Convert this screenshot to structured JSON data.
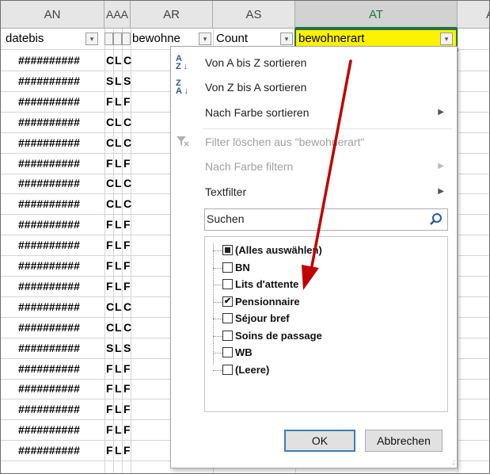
{
  "columns": [
    {
      "label": "AN"
    },
    {
      "label": "AAA"
    },
    {
      "label": "AR"
    },
    {
      "label": "AS"
    },
    {
      "label": "AT"
    },
    {
      "label": "A"
    }
  ],
  "header_row": {
    "col_an": "datebis",
    "col_aaa": "",
    "col_ar": "bewohne",
    "col_as": "Count",
    "col_at": "bewohnerart",
    "filter_glyph": "▾"
  },
  "rows": [
    {
      "an": "##########",
      "a1": "C",
      "a2": "L",
      "a3": "C"
    },
    {
      "an": "##########",
      "a1": "S",
      "a2": "L",
      "a3": "S"
    },
    {
      "an": "##########",
      "a1": "F",
      "a2": "L",
      "a3": "F"
    },
    {
      "an": "##########",
      "a1": "C",
      "a2": "L",
      "a3": "C"
    },
    {
      "an": "##########",
      "a1": "C",
      "a2": "L",
      "a3": "C"
    },
    {
      "an": "##########",
      "a1": "F",
      "a2": "L",
      "a3": "F"
    },
    {
      "an": "##########",
      "a1": "C",
      "a2": "L",
      "a3": "C"
    },
    {
      "an": "##########",
      "a1": "C",
      "a2": "L",
      "a3": "C"
    },
    {
      "an": "##########",
      "a1": "F",
      "a2": "L",
      "a3": "F"
    },
    {
      "an": "##########",
      "a1": "F",
      "a2": "L",
      "a3": "F"
    },
    {
      "an": "##########",
      "a1": "F",
      "a2": "L",
      "a3": "F"
    },
    {
      "an": "##########",
      "a1": "F",
      "a2": "L",
      "a3": "F"
    },
    {
      "an": "##########",
      "a1": "C",
      "a2": "L",
      "a3": "C"
    },
    {
      "an": "##########",
      "a1": "C",
      "a2": "L",
      "a3": "C"
    },
    {
      "an": "##########",
      "a1": "S",
      "a2": "L",
      "a3": "S"
    },
    {
      "an": "##########",
      "a1": "F",
      "a2": "L",
      "a3": "F"
    },
    {
      "an": "##########",
      "a1": "F",
      "a2": "L",
      "a3": "F"
    },
    {
      "an": "##########",
      "a1": "F",
      "a2": "L",
      "a3": "F"
    },
    {
      "an": "##########",
      "a1": "F",
      "a2": "L",
      "a3": "F"
    },
    {
      "an": "##########",
      "a1": "F",
      "a2": "L",
      "a3": "F"
    }
  ],
  "menu": {
    "sort_az": "Von A bis Z sortieren",
    "sort_za": "Von Z bis A sortieren",
    "sort_color": "Nach Farbe sortieren",
    "clear_filter": "Filter löschen aus \"bewohnerart\"",
    "filter_color": "Nach Farbe filtern",
    "text_filter": "Textfilter",
    "submenu_glyph": "▶",
    "sort_az_icon_top": "A",
    "sort_az_icon_bottom": "Z",
    "sort_za_icon_top": "Z",
    "sort_za_icon_bottom": "A"
  },
  "search": {
    "placeholder": "Suchen"
  },
  "filter_list": [
    {
      "label": "(Alles auswählen)",
      "state": "partial"
    },
    {
      "label": "BN",
      "state": "unchecked"
    },
    {
      "label": "Lits d'attente",
      "state": "unchecked"
    },
    {
      "label": "Pensionnaire",
      "state": "checked"
    },
    {
      "label": "Séjour bref",
      "state": "unchecked"
    },
    {
      "label": "Soins de passage",
      "state": "unchecked"
    },
    {
      "label": "WB",
      "state": "unchecked"
    },
    {
      "label": "(Leere)",
      "state": "unchecked"
    }
  ],
  "buttons": {
    "ok": "OK",
    "cancel": "Abbrechen"
  },
  "colors": {
    "selected_cell": "#fff200",
    "excel_green": "#217346",
    "arrow_red": "#c00000"
  }
}
